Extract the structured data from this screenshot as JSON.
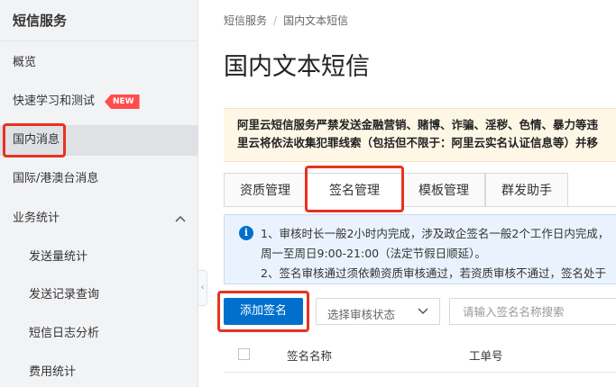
{
  "sidebar": {
    "title": "短信服务",
    "items": [
      {
        "label": "概览"
      },
      {
        "label": "快速学习和测试",
        "badge": "NEW"
      },
      {
        "label": "国内消息"
      },
      {
        "label": "国际/港澳台消息"
      },
      {
        "label": "业务统计"
      },
      {
        "label": "发送量统计"
      },
      {
        "label": "发送记录查询"
      },
      {
        "label": "短信日志分析"
      },
      {
        "label": "费用统计"
      }
    ]
  },
  "breadcrumb": [
    "短信服务",
    "国内文本短信"
  ],
  "page_title": "国内文本短信",
  "notice": {
    "line1": "阿里云短信服务严禁发送金融营销、赌博、诈骗、淫秽、色情、暴力等违",
    "line2": "里云将依法收集犯罪线索（包括但不限于：阿里云实名认证信息等）并移"
  },
  "tabs": [
    {
      "label": "资质管理"
    },
    {
      "label": "签名管理"
    },
    {
      "label": "模板管理"
    },
    {
      "label": "群发助手"
    }
  ],
  "info": {
    "icon": "i",
    "line1": "1、审核时长一般2小时内完成，涉及政企签名一般2个工作日内完成，",
    "line2": "周一至周日9:00-21:00（法定节假日顺延）。",
    "line3": "2、签名审核通过须依赖资质审核通过，若资质审核不通过，签名处于"
  },
  "toolbar": {
    "add_label": "添加签名",
    "status_select": "选择审核状态",
    "search_placeholder": "请输入签名名称搜索"
  },
  "table": {
    "headers": [
      "签名名称",
      "工单号"
    ]
  },
  "colors": {
    "primary": "#0070cc",
    "highlight_box": "#e8321f",
    "badge": "#ff4d4f"
  }
}
